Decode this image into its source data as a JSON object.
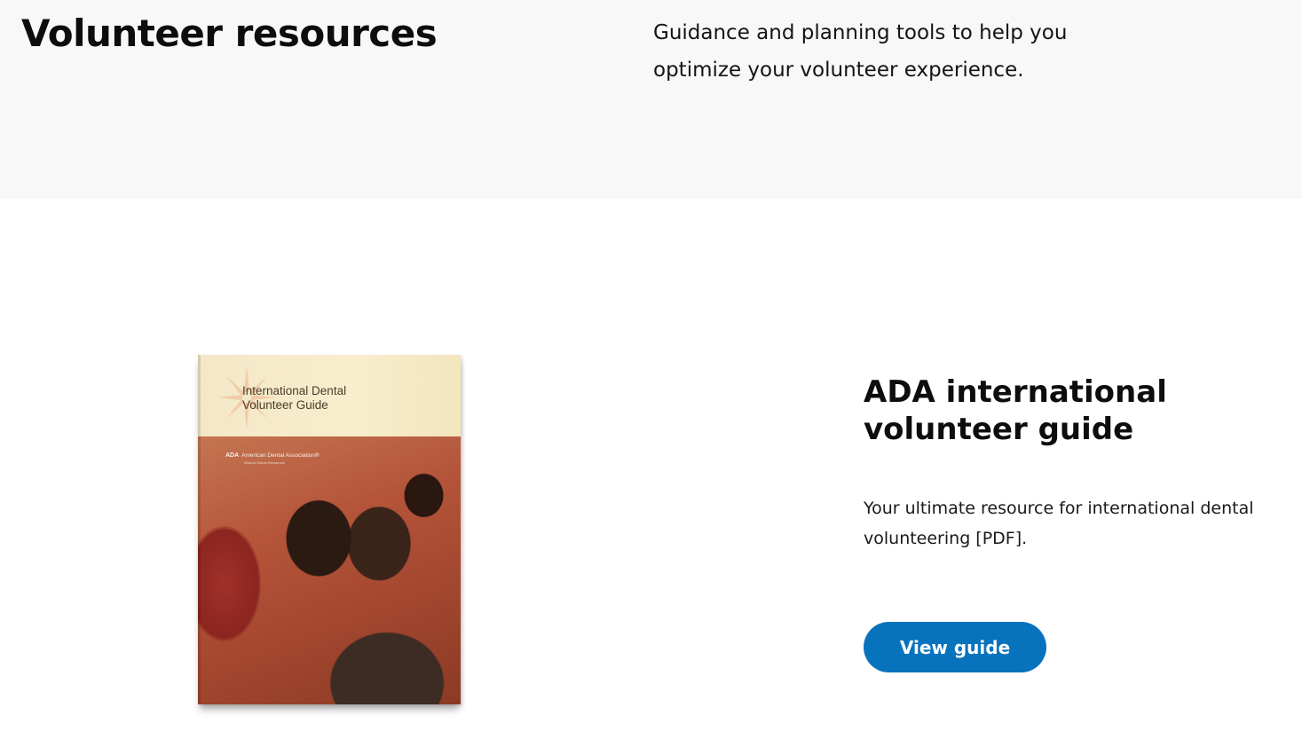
{
  "hero": {
    "title": "Volunteer resources",
    "description": "Guidance and planning tools to help you optimize your volunteer experience."
  },
  "resource": {
    "cover": {
      "title_line1": "International Dental",
      "title_line2": "Volunteer Guide",
      "brand_mark": "ADA",
      "brand_name": "American Dental Association®",
      "brand_sub": "Shared Global Resources"
    },
    "title": "ADA international volunteer guide",
    "description": "Your ultimate resource for international dental volunteering [PDF].",
    "button_label": "View guide"
  },
  "colors": {
    "hero_background": "#f8f8f8",
    "button_background": "#0873bd",
    "button_text": "#ffffff"
  }
}
